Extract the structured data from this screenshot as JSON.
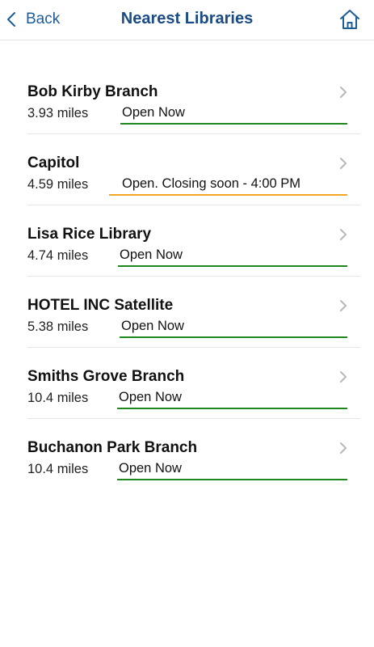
{
  "nav": {
    "back_label": "Back",
    "title": "Nearest Libraries",
    "back_icon": "chevron-left-icon",
    "home_icon": "home-icon"
  },
  "colors": {
    "nav_text": "#1f5c9a",
    "title": "#1a4b86",
    "open": "#1e8a1e",
    "closing_soon": "#f5a623"
  },
  "libraries": [
    {
      "name": "Bob Kirby Branch",
      "distance": "3.93 miles",
      "status": "Open Now",
      "status_type": "open"
    },
    {
      "name": "Capitol",
      "distance": "4.59 miles",
      "status": "Open. Closing soon - 4:00 PM",
      "status_type": "closing_soon"
    },
    {
      "name": "Lisa Rice Library",
      "distance": "4.74 miles",
      "status": "Open Now",
      "status_type": "open"
    },
    {
      "name": "HOTEL INC Satellite",
      "distance": "5.38 miles",
      "status": "Open Now",
      "status_type": "open"
    },
    {
      "name": "Smiths Grove Branch",
      "distance": "10.4 miles",
      "status": "Open Now",
      "status_type": "open"
    },
    {
      "name": "Buchanon Park Branch",
      "distance": "10.4 miles",
      "status": "Open Now",
      "status_type": "open"
    }
  ]
}
